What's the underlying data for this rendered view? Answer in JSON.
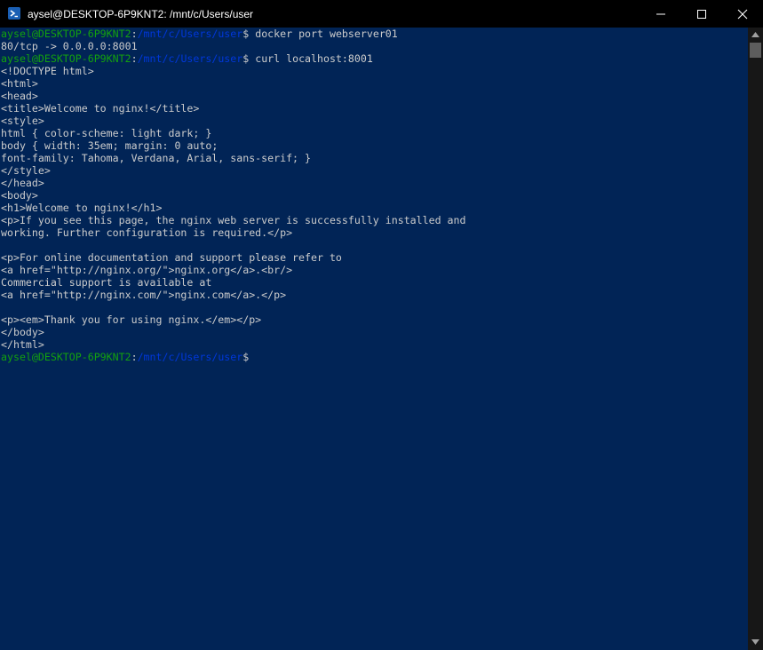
{
  "window": {
    "title": "aysel@DESKTOP-6P9KNT2: /mnt/c/Users/user"
  },
  "colors": {
    "background": "#012456",
    "prompt_user": "#13a10e",
    "prompt_path": "#0037da",
    "text": "#cccccc",
    "titlebar": "#000000"
  },
  "icons": {
    "app": "powershell-icon",
    "minimize": "minimize-icon",
    "maximize": "maximize-icon",
    "close": "close-icon"
  },
  "prompt": {
    "user_host": "aysel@DESKTOP-6P9KNT2",
    "sep": ":",
    "path": "/mnt/c/Users/user",
    "dollar": "$"
  },
  "terminal": {
    "cmd1": " docker port webserver01",
    "out1": "80/tcp -> 0.0.0.0:8001",
    "cmd2": " curl localhost:8001",
    "output": [
      "<!DOCTYPE html>",
      "<html>",
      "<head>",
      "<title>Welcome to nginx!</title>",
      "<style>",
      "html { color-scheme: light dark; }",
      "body { width: 35em; margin: 0 auto;",
      "font-family: Tahoma, Verdana, Arial, sans-serif; }",
      "</style>",
      "</head>",
      "<body>",
      "<h1>Welcome to nginx!</h1>",
      "<p>If you see this page, the nginx web server is successfully installed and",
      "working. Further configuration is required.</p>",
      "",
      "<p>For online documentation and support please refer to",
      "<a href=\"http://nginx.org/\">nginx.org</a>.<br/>",
      "Commercial support is available at",
      "<a href=\"http://nginx.com/\">nginx.com</a>.</p>",
      "",
      "<p><em>Thank you for using nginx.</em></p>",
      "</body>",
      "</html>"
    ]
  }
}
